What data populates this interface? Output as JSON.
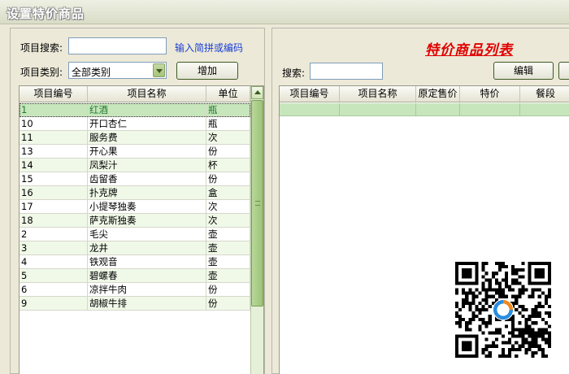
{
  "window": {
    "title": "设置特价商品"
  },
  "left": {
    "search_label": "项目搜索:",
    "search_value": "",
    "search_hint": "输入简拼或编码",
    "category_label": "项目类别:",
    "category_value": "全部类别",
    "add_label": "增加",
    "columns": [
      "项目编号",
      "项目名称",
      "单位"
    ],
    "rows": [
      [
        "1",
        "红酒",
        "瓶"
      ],
      [
        "10",
        "开口杏仁",
        "瓶"
      ],
      [
        "11",
        "服务费",
        "次"
      ],
      [
        "13",
        "开心果",
        "份"
      ],
      [
        "14",
        "凤梨汁",
        "杯"
      ],
      [
        "15",
        "齿留香",
        "份"
      ],
      [
        "16",
        "扑克牌",
        "盒"
      ],
      [
        "17",
        "小提琴独奏",
        "次"
      ],
      [
        "18",
        "萨克斯独奏",
        "次"
      ],
      [
        "2",
        "毛尖",
        "壶"
      ],
      [
        "3",
        "龙井",
        "壶"
      ],
      [
        "4",
        "铁观音",
        "壶"
      ],
      [
        "5",
        "碧螺春",
        "壶"
      ],
      [
        "6",
        "凉拌牛肉",
        "份"
      ],
      [
        "9",
        "胡椒牛排",
        "份"
      ]
    ],
    "selected_index": 0
  },
  "right": {
    "heading": "特价商品列表",
    "search_label": "搜索:",
    "search_value": "",
    "edit_label": "编辑",
    "columns": [
      "项目编号",
      "项目名称",
      "原定售价",
      "特价",
      "餐段"
    ]
  },
  "colors": {
    "selected_row": "#c7e6bc",
    "alt_row": "#f0f9e8",
    "heading": "#e00000",
    "link": "#1a3fd6"
  }
}
